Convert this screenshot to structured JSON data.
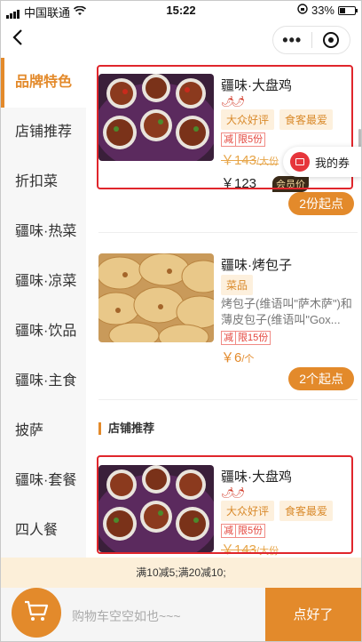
{
  "status_bar": {
    "carrier": "中国联通",
    "time": "15:22",
    "battery": "33%"
  },
  "sidebar": {
    "items": [
      {
        "label": "品牌特色"
      },
      {
        "label": "店铺推荐"
      },
      {
        "label": "折扣菜"
      },
      {
        "label": "疆味·热菜"
      },
      {
        "label": "疆味·凉菜"
      },
      {
        "label": "疆味·饮品"
      },
      {
        "label": "疆味·主食"
      },
      {
        "label": "披萨"
      },
      {
        "label": "疆味·套餐"
      },
      {
        "label": "四人餐"
      }
    ]
  },
  "products": [
    {
      "name": "疆味·大盘鸡",
      "tags": [
        "大众好评",
        "食客最爱"
      ],
      "promo_label": "减",
      "promo_limit": "限5份",
      "old_price": "￥143",
      "old_unit": "/大份",
      "vip_price": "￥123",
      "vip_label": "会员价",
      "min_order": "2份起点"
    },
    {
      "name": "疆味·烤包子",
      "tags": [
        "菜品"
      ],
      "desc": "烤包子(维语叫\"萨木萨\")和薄皮包子(维语叫\"Gox...",
      "promo_label": "减",
      "promo_limit": "限15份",
      "price": "￥6",
      "price_unit": "/个",
      "min_order": "2个起点"
    },
    {
      "name": "疆味·大盘鸡",
      "tags": [
        "大众好评",
        "食客最爱"
      ],
      "promo_label": "减",
      "promo_limit": "限5份",
      "old_price": "￥143",
      "old_unit": "/大份"
    }
  ],
  "section_title": "店铺推荐",
  "coupon": {
    "label": "我的券"
  },
  "promo_bar": "满10减5;满20减10;",
  "cart": {
    "empty_text": "购物车空空如也~~~",
    "checkout_label": "点好了"
  },
  "colors": {
    "accent": "#e38a2b",
    "highlight_box": "#e0262c"
  }
}
